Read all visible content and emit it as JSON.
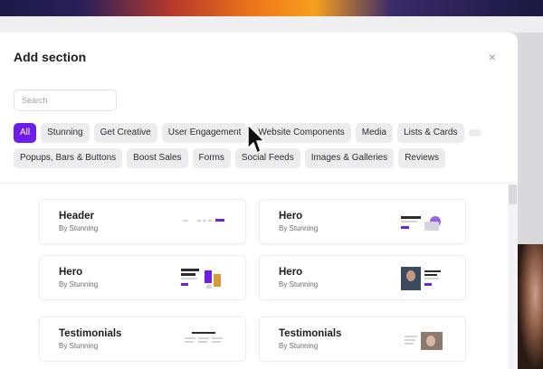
{
  "modal": {
    "title": "Add section",
    "close_label": "×"
  },
  "search": {
    "placeholder": "Search",
    "value": ""
  },
  "filters": {
    "row1": [
      "All",
      "Stunning",
      "Get Creative",
      "User Engagement",
      "Website Components",
      "Media",
      "Lists & Cards"
    ],
    "row2": [
      "Popups, Bars & Buttons",
      "Boost Sales",
      "Forms",
      "Social Feeds",
      "Images & Galleries",
      "Reviews"
    ],
    "active": "All"
  },
  "sections": [
    {
      "name": "Header",
      "by": "By Stunning"
    },
    {
      "name": "Hero",
      "by": "By Stunning"
    },
    {
      "name": "Hero",
      "by": "By Stunning"
    },
    {
      "name": "Hero",
      "by": "By Stunning"
    },
    {
      "name": "Testimonials",
      "by": "By Stunning"
    },
    {
      "name": "Testimonials",
      "by": "By Stunning"
    }
  ],
  "colors": {
    "accent": "#6e1ee8",
    "chip_bg": "#ececee"
  }
}
